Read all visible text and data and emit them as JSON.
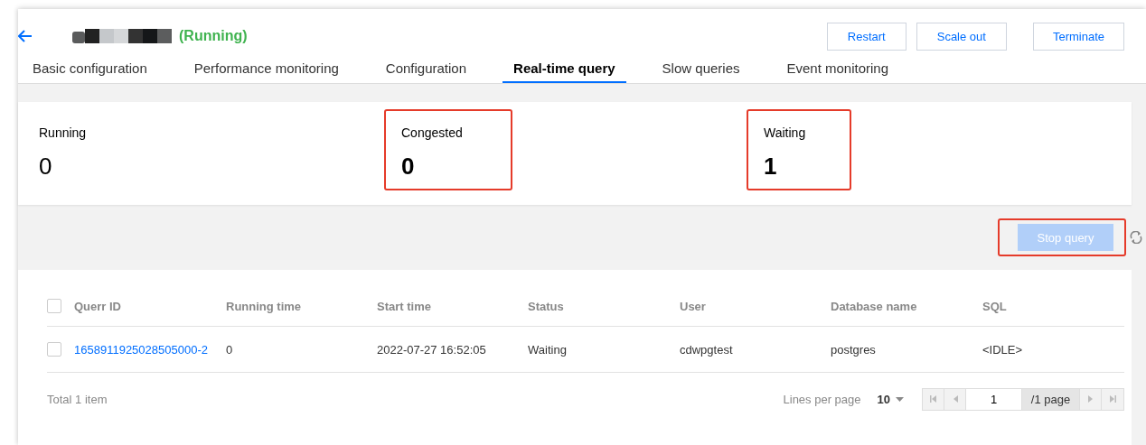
{
  "header": {
    "status": "(Running)",
    "buttons": [
      "Restart",
      "Scale out",
      "Terminate"
    ]
  },
  "tabs": [
    {
      "label": "Basic configuration",
      "selected": false
    },
    {
      "label": "Performance monitoring",
      "selected": false
    },
    {
      "label": "Configuration",
      "selected": false
    },
    {
      "label": "Real-time query",
      "selected": true
    },
    {
      "label": "Slow queries",
      "selected": false
    },
    {
      "label": "Event monitoring",
      "selected": false
    }
  ],
  "stats": [
    {
      "label": "Running",
      "value": "0",
      "highlighted": false
    },
    {
      "label": "Congested",
      "value": "0",
      "highlighted": true
    },
    {
      "label": "Waiting",
      "value": "1",
      "highlighted": true
    }
  ],
  "toolbar": {
    "stop_button": {
      "label": "Stop query",
      "disabled": true,
      "highlighted": true
    }
  },
  "table": {
    "columns": [
      "Querr ID",
      "Running time",
      "Start time",
      "Status",
      "User",
      "Database name",
      "SQL"
    ],
    "rows": [
      {
        "checked": false,
        "cells": [
          "1658911925028505000-2",
          "0",
          "2022-07-27 16:52:05",
          "Waiting",
          "cdwpgtest",
          "postgres",
          "<IDLE>"
        ]
      }
    ],
    "header_checked": false
  },
  "footer": {
    "total": "Total 1 item",
    "lines_label": "Lines per page",
    "page_size": "10",
    "page": "1",
    "page_total": "/1 page"
  }
}
